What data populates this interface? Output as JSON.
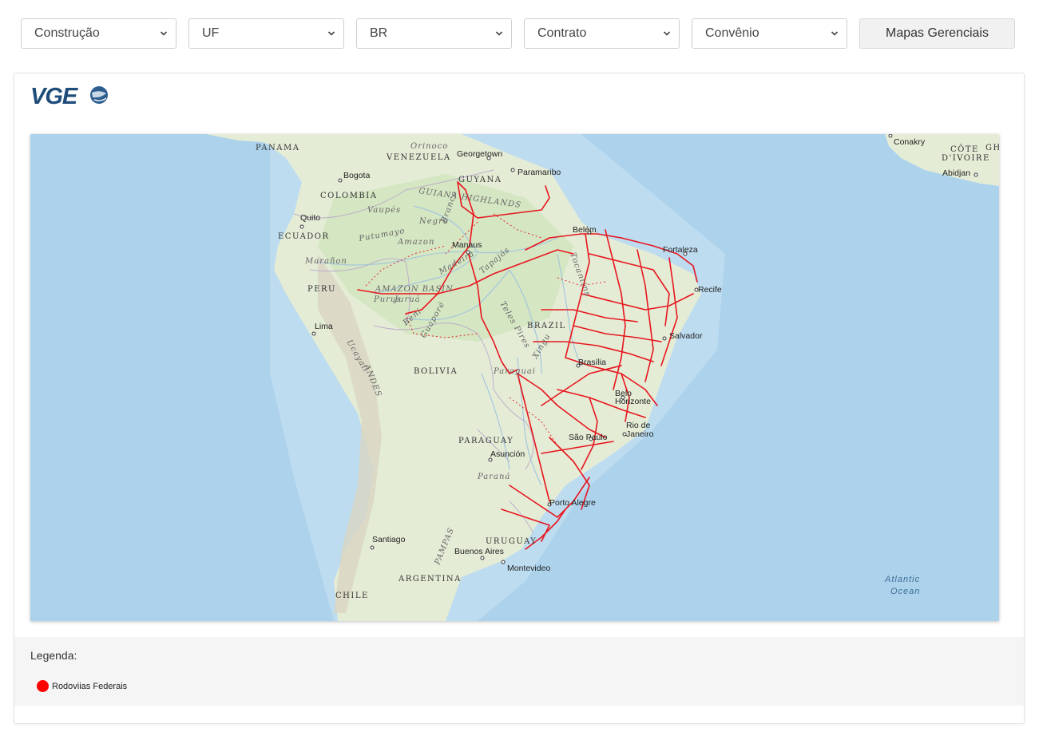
{
  "filters": [
    {
      "value": "Construção"
    },
    {
      "value": "UF"
    },
    {
      "value": "BR"
    },
    {
      "value": "Contrato"
    },
    {
      "value": "Convênio"
    }
  ],
  "action_button": "Mapas Gerenciais",
  "logo": {
    "text": "VGE"
  },
  "map": {
    "countries": [
      "PANAMA",
      "VENEZUELA",
      "GUYANA",
      "COLOMBIA",
      "ECUADOR",
      "PERU",
      "BRAZIL",
      "BOLIVIA",
      "PARAGUAY",
      "URUGUAY",
      "ARGENTINA",
      "CHILE",
      "CÔTE",
      "D'IVOIRE",
      "GH"
    ],
    "cities": [
      "Georgetown",
      "Paramaribo",
      "Bogota",
      "Quito",
      "Manaus",
      "Belém",
      "Fortaleza",
      "Recife",
      "Lima",
      "Salvador",
      "Brasília",
      "Belo",
      "Horizonte",
      "Rio de",
      "Janeiro",
      "São Paulo",
      "Asunción",
      "Porto Alegre",
      "Santiago",
      "Buenos Aires",
      "Montevideo",
      "Conakry",
      "Abidjan"
    ],
    "features": [
      "GUIANA HIGHLANDS",
      "AMAZON BASIN",
      "ANDES",
      "PAMPAS",
      "Orinoco",
      "Negro",
      "Branco",
      "Amazon",
      "Putumayo",
      "Vaupés",
      "Marañon",
      "Purus",
      "Madeira",
      "Tapajós",
      "Xingu",
      "Tocantins",
      "Beni",
      "Guaporé",
      "Teles Pires",
      "Paraguai",
      "Paraná",
      "Ucayali",
      "Juruá"
    ],
    "ocean_label": [
      "Atlantic",
      "Ocean"
    ],
    "route_color": "#e8161e"
  },
  "legend": {
    "title": "Legenda:",
    "items": [
      {
        "label": "Rodoviias Federais",
        "color": "#ff0000"
      }
    ]
  }
}
